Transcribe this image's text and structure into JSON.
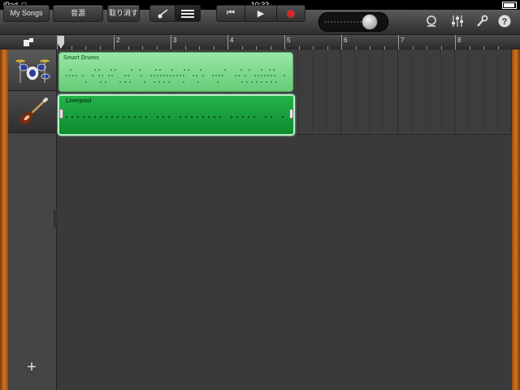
{
  "status": {
    "device": "iPad",
    "time": "10:33"
  },
  "toolbar": {
    "my_songs": "My Songs",
    "instruments": "音源",
    "undo": "取り消す",
    "transport": {
      "rewind": "⏮",
      "play": "▶"
    }
  },
  "ruler": {
    "bars": [
      "1",
      "2",
      "3",
      "4",
      "5",
      "6",
      "7",
      "8"
    ]
  },
  "tracks": [
    {
      "name": "Smart Drums",
      "icon": "drum-kit-icon"
    },
    {
      "name": "Liverpool",
      "icon": "bass-guitar-icon"
    }
  ],
  "regions": [
    {
      "label": "Smart Drums",
      "color": "#7ad98a"
    },
    {
      "label": "Liverpool",
      "color": "#17a03c"
    }
  ],
  "add_track": "+",
  "colors": {
    "wood": "#d07420",
    "region_light": "#7ad98a",
    "region_dark": "#17a03c",
    "record": "#e82020"
  }
}
